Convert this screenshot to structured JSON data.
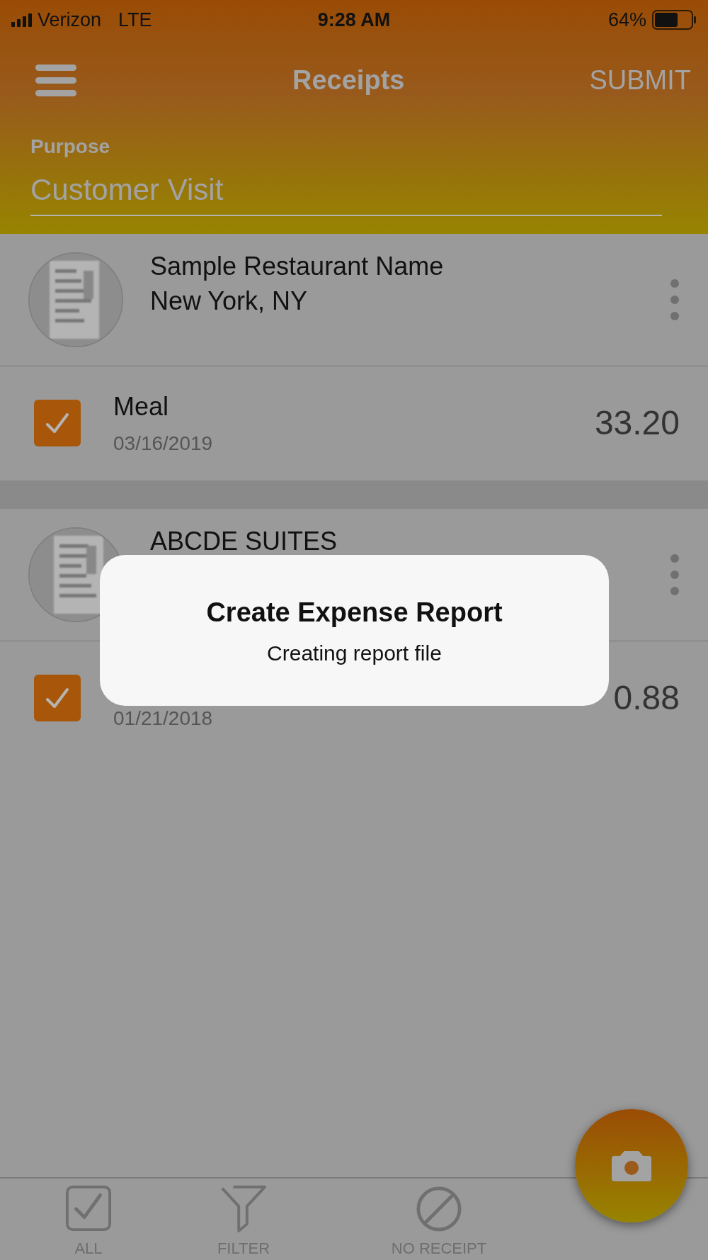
{
  "status_bar": {
    "carrier": "Verizon",
    "network": "LTE",
    "time": "9:28 AM",
    "battery": "64%"
  },
  "header": {
    "title": "Receipts",
    "action": "SUBMIT"
  },
  "purpose": {
    "label": "Purpose",
    "value": "Customer Visit"
  },
  "receipts": [
    {
      "merchant": "Sample Restaurant Name",
      "location": "New York, NY",
      "items": [
        {
          "category": "Meal",
          "date": "03/16/2019",
          "amount": "33.20",
          "checked": true
        }
      ]
    },
    {
      "merchant": "ABCDE SUITES",
      "items": [
        {
          "date": "01/21/2018",
          "amount": "0.88",
          "checked": true
        }
      ]
    }
  ],
  "dialog": {
    "title": "Create Expense Report",
    "message": "Creating report file"
  },
  "toolbar": [
    {
      "label": "ALL",
      "kind": "all"
    },
    {
      "label": "FILTER",
      "kind": "filter"
    },
    {
      "label": "NO RECEIPT",
      "kind": "no-receipt"
    }
  ]
}
